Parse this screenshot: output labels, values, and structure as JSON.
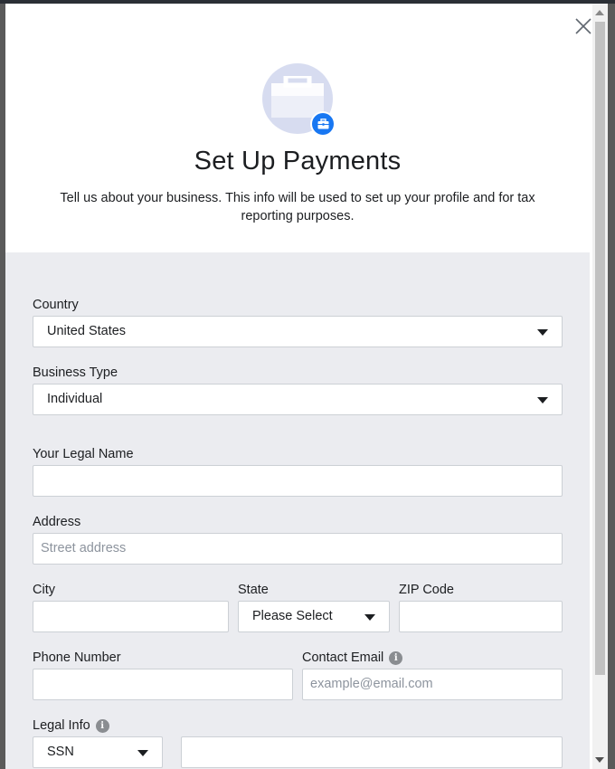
{
  "dialog": {
    "title": "Set Up Payments",
    "subtitle": "Tell us about your business. This info will be used to set up your profile and for tax reporting purposes."
  },
  "form": {
    "country": {
      "label": "Country",
      "value": "United States"
    },
    "business_type": {
      "label": "Business Type",
      "value": "Individual"
    },
    "legal_name": {
      "label": "Your Legal Name",
      "value": ""
    },
    "address": {
      "label": "Address",
      "placeholder": "Street address",
      "value": ""
    },
    "city": {
      "label": "City",
      "value": ""
    },
    "state": {
      "label": "State",
      "value": "Please Select"
    },
    "zip": {
      "label": "ZIP Code",
      "value": ""
    },
    "phone": {
      "label": "Phone Number",
      "value": ""
    },
    "email": {
      "label": "Contact Email",
      "placeholder": "example@email.com",
      "value": ""
    },
    "legal_info": {
      "label": "Legal Info",
      "type_value": "SSN",
      "number_value": ""
    }
  },
  "icons": {
    "close": "close-icon",
    "badge": "briefcase-icon",
    "info": "info-icon",
    "caret": "caret-down-icon"
  },
  "colors": {
    "accent": "#1877f2",
    "form_background": "#ebecf0",
    "avatar_background": "#d7dcf0"
  }
}
